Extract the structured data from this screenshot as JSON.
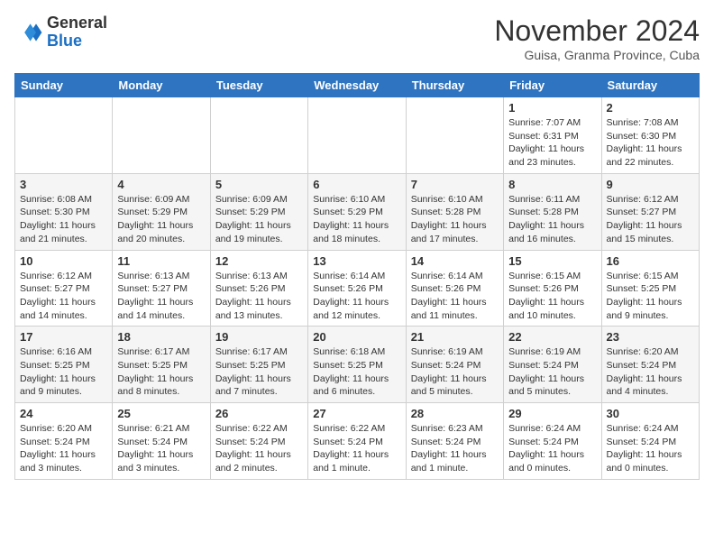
{
  "header": {
    "logo_general": "General",
    "logo_blue": "Blue",
    "month_title": "November 2024",
    "subtitle": "Guisa, Granma Province, Cuba"
  },
  "days_of_week": [
    "Sunday",
    "Monday",
    "Tuesday",
    "Wednesday",
    "Thursday",
    "Friday",
    "Saturday"
  ],
  "weeks": [
    [
      {
        "day": "",
        "info": ""
      },
      {
        "day": "",
        "info": ""
      },
      {
        "day": "",
        "info": ""
      },
      {
        "day": "",
        "info": ""
      },
      {
        "day": "",
        "info": ""
      },
      {
        "day": "1",
        "info": "Sunrise: 7:07 AM\nSunset: 6:31 PM\nDaylight: 11 hours and 23 minutes."
      },
      {
        "day": "2",
        "info": "Sunrise: 7:08 AM\nSunset: 6:30 PM\nDaylight: 11 hours and 22 minutes."
      }
    ],
    [
      {
        "day": "3",
        "info": "Sunrise: 6:08 AM\nSunset: 5:30 PM\nDaylight: 11 hours and 21 minutes."
      },
      {
        "day": "4",
        "info": "Sunrise: 6:09 AM\nSunset: 5:29 PM\nDaylight: 11 hours and 20 minutes."
      },
      {
        "day": "5",
        "info": "Sunrise: 6:09 AM\nSunset: 5:29 PM\nDaylight: 11 hours and 19 minutes."
      },
      {
        "day": "6",
        "info": "Sunrise: 6:10 AM\nSunset: 5:29 PM\nDaylight: 11 hours and 18 minutes."
      },
      {
        "day": "7",
        "info": "Sunrise: 6:10 AM\nSunset: 5:28 PM\nDaylight: 11 hours and 17 minutes."
      },
      {
        "day": "8",
        "info": "Sunrise: 6:11 AM\nSunset: 5:28 PM\nDaylight: 11 hours and 16 minutes."
      },
      {
        "day": "9",
        "info": "Sunrise: 6:12 AM\nSunset: 5:27 PM\nDaylight: 11 hours and 15 minutes."
      }
    ],
    [
      {
        "day": "10",
        "info": "Sunrise: 6:12 AM\nSunset: 5:27 PM\nDaylight: 11 hours and 14 minutes."
      },
      {
        "day": "11",
        "info": "Sunrise: 6:13 AM\nSunset: 5:27 PM\nDaylight: 11 hours and 14 minutes."
      },
      {
        "day": "12",
        "info": "Sunrise: 6:13 AM\nSunset: 5:26 PM\nDaylight: 11 hours and 13 minutes."
      },
      {
        "day": "13",
        "info": "Sunrise: 6:14 AM\nSunset: 5:26 PM\nDaylight: 11 hours and 12 minutes."
      },
      {
        "day": "14",
        "info": "Sunrise: 6:14 AM\nSunset: 5:26 PM\nDaylight: 11 hours and 11 minutes."
      },
      {
        "day": "15",
        "info": "Sunrise: 6:15 AM\nSunset: 5:26 PM\nDaylight: 11 hours and 10 minutes."
      },
      {
        "day": "16",
        "info": "Sunrise: 6:15 AM\nSunset: 5:25 PM\nDaylight: 11 hours and 9 minutes."
      }
    ],
    [
      {
        "day": "17",
        "info": "Sunrise: 6:16 AM\nSunset: 5:25 PM\nDaylight: 11 hours and 9 minutes."
      },
      {
        "day": "18",
        "info": "Sunrise: 6:17 AM\nSunset: 5:25 PM\nDaylight: 11 hours and 8 minutes."
      },
      {
        "day": "19",
        "info": "Sunrise: 6:17 AM\nSunset: 5:25 PM\nDaylight: 11 hours and 7 minutes."
      },
      {
        "day": "20",
        "info": "Sunrise: 6:18 AM\nSunset: 5:25 PM\nDaylight: 11 hours and 6 minutes."
      },
      {
        "day": "21",
        "info": "Sunrise: 6:19 AM\nSunset: 5:24 PM\nDaylight: 11 hours and 5 minutes."
      },
      {
        "day": "22",
        "info": "Sunrise: 6:19 AM\nSunset: 5:24 PM\nDaylight: 11 hours and 5 minutes."
      },
      {
        "day": "23",
        "info": "Sunrise: 6:20 AM\nSunset: 5:24 PM\nDaylight: 11 hours and 4 minutes."
      }
    ],
    [
      {
        "day": "24",
        "info": "Sunrise: 6:20 AM\nSunset: 5:24 PM\nDaylight: 11 hours and 3 minutes."
      },
      {
        "day": "25",
        "info": "Sunrise: 6:21 AM\nSunset: 5:24 PM\nDaylight: 11 hours and 3 minutes."
      },
      {
        "day": "26",
        "info": "Sunrise: 6:22 AM\nSunset: 5:24 PM\nDaylight: 11 hours and 2 minutes."
      },
      {
        "day": "27",
        "info": "Sunrise: 6:22 AM\nSunset: 5:24 PM\nDaylight: 11 hours and 1 minute."
      },
      {
        "day": "28",
        "info": "Sunrise: 6:23 AM\nSunset: 5:24 PM\nDaylight: 11 hours and 1 minute."
      },
      {
        "day": "29",
        "info": "Sunrise: 6:24 AM\nSunset: 5:24 PM\nDaylight: 11 hours and 0 minutes."
      },
      {
        "day": "30",
        "info": "Sunrise: 6:24 AM\nSunset: 5:24 PM\nDaylight: 11 hours and 0 minutes."
      }
    ]
  ]
}
